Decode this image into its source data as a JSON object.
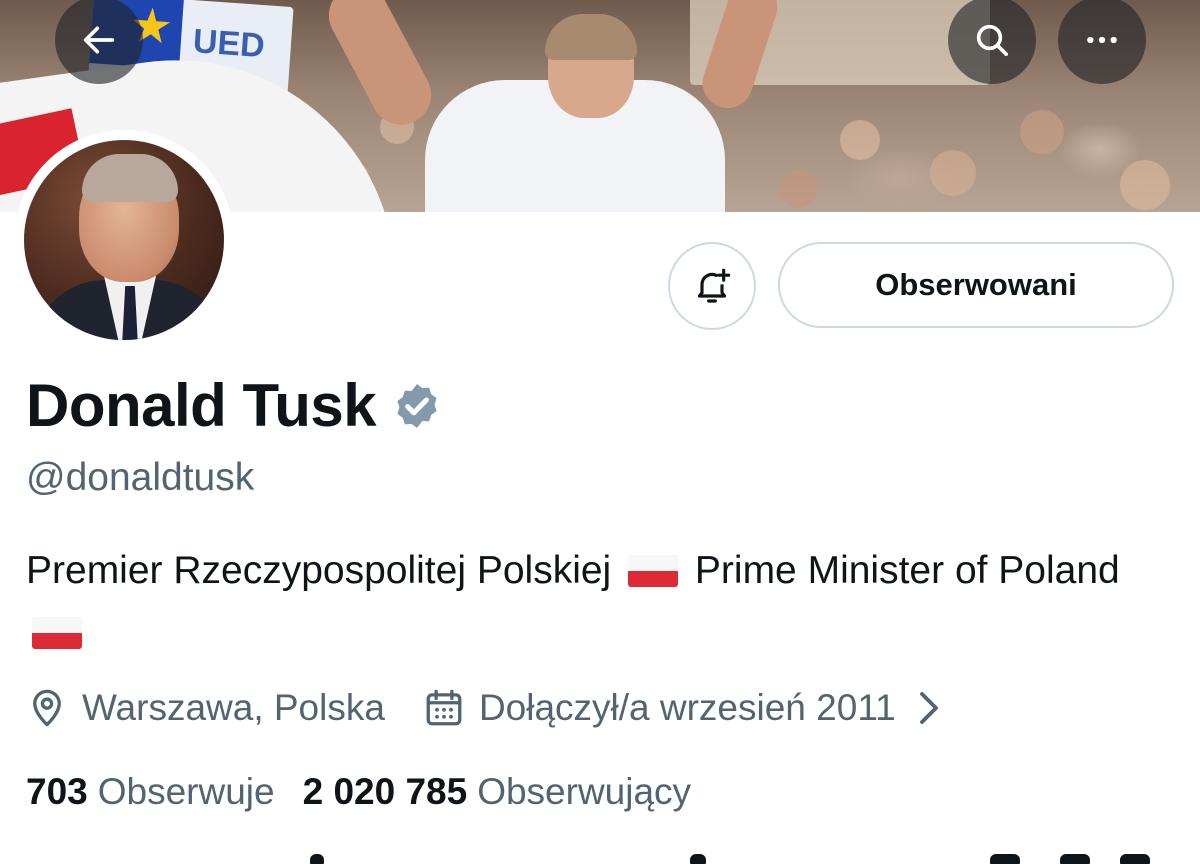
{
  "header": {
    "back_icon": "arrow-left-icon",
    "search_icon": "search-icon",
    "more_icon": "more-horizontal-icon",
    "banner_sign_text": "UED"
  },
  "profile": {
    "display_name": "Donald Tusk",
    "verified_badge_icon": "verified-badge-icon",
    "verified_badge_color": "#829aab",
    "handle": "@donaldtusk",
    "bio_part1": "Premier Rzeczypospolitej Polskiej",
    "bio_part2": "Prime Minister of Poland",
    "bio_flag_icon": "poland-flag-emoji",
    "location": "Warszawa, Polska",
    "location_icon": "location-pin-icon",
    "joined": "Dołączył/a wrzesień 2011",
    "joined_icon": "calendar-icon",
    "joined_chevron_icon": "chevron-right-icon"
  },
  "actions": {
    "notify_icon": "bell-plus-icon",
    "follow_label": "Obserwowani"
  },
  "stats": {
    "following_count": "703",
    "following_label": "Obserwuje",
    "followers_count": "2 020 785",
    "followers_label": "Obserwujący"
  },
  "colors": {
    "text_primary": "#0f1419",
    "text_secondary": "#536471",
    "button_border": "#cfd9de",
    "flag_red": "#dc2a37"
  }
}
